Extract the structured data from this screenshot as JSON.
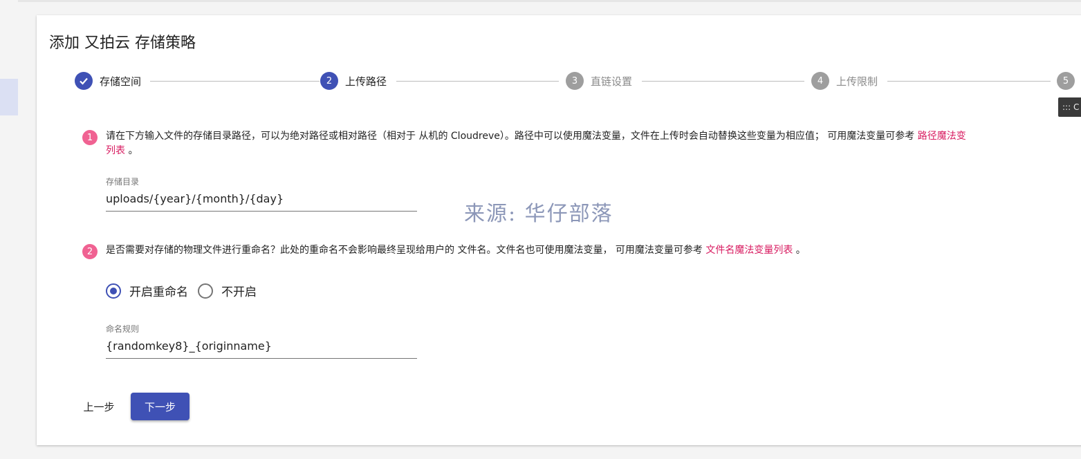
{
  "page": {
    "title": "添加 又拍云 存储策略"
  },
  "stepper": {
    "steps": [
      {
        "num": "",
        "label": "存储空间",
        "state": "done"
      },
      {
        "num": "2",
        "label": "上传路径",
        "state": "active"
      },
      {
        "num": "3",
        "label": "直链设置",
        "state": "pending"
      },
      {
        "num": "4",
        "label": "上传限制",
        "state": "pending"
      },
      {
        "num": "5",
        "label": "",
        "state": "pending"
      }
    ]
  },
  "tooltip_chip": {
    "text": "::: C"
  },
  "section1": {
    "badge": "1",
    "text_line1": "请在下方输入文件的存储目录路径，可以为绝对路径或相对路径（相对于 从机的 Cloudreve）。路径中可以使用魔法变量，文件在上传时会自动替换这些变量为相应值； 可用魔法变量可参考 ",
    "link_part1": "路径魔法变",
    "link_part2": "列表",
    "text_end": " 。"
  },
  "storage_dir": {
    "label": "存储目录",
    "value": "uploads/{year}/{month}/{day}"
  },
  "section2": {
    "badge": "2",
    "text": "是否需要对存储的物理文件进行重命名？此处的重命名不会影响最终呈现给用户的 文件名。文件名也可使用魔法变量， 可用魔法变量可参考 ",
    "link": "文件名魔法变量列表",
    "text_end": " 。"
  },
  "rename_options": [
    {
      "label": "开启重命名",
      "checked": true
    },
    {
      "label": "不开启",
      "checked": false
    }
  ],
  "naming_rule": {
    "label": "命名规则",
    "value": "{randomkey8}_{originname}"
  },
  "actions": {
    "back": "上一步",
    "next": "下一步"
  },
  "watermark": "来源: 华仔部落",
  "colors": {
    "primary": "#3f51b5",
    "accent": "#d81b60",
    "badge": "#f06292",
    "pending": "#9e9e9e"
  }
}
